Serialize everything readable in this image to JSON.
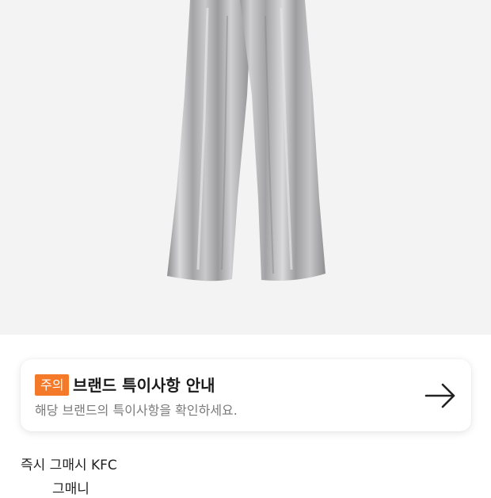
{
  "product": {
    "image_icon": "product-image-silver-pants"
  },
  "notice": {
    "badge": "주의",
    "title": "브랜드 특이사항 안내",
    "description": "해당 브랜드의 특이사항을 확인하세요.",
    "arrow_icon": "arrow-right-icon",
    "badge_color": "#f47a2a"
  },
  "partial_text": {
    "line1": "즉시 그매시 KFC",
    "line2": "그매니"
  }
}
